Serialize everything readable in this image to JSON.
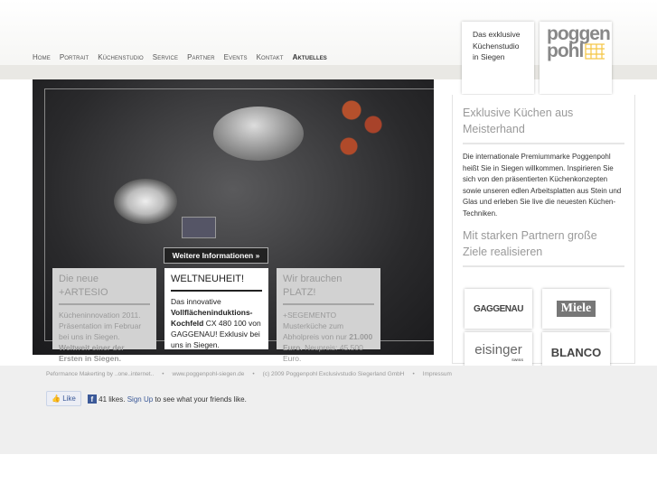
{
  "nav": [
    "Home",
    "Portrait",
    "Küchenstudio",
    "Service",
    "Partner",
    "Events",
    "Kontakt",
    "Aktuelles"
  ],
  "tagline": "Das exklusive Küchenstudio in Siegen",
  "logo": {
    "line1": "poggen",
    "line2": "pohl",
    "accent": "#f5c542"
  },
  "hero": {
    "button": "Weitere Informationen »",
    "boxes": [
      {
        "title": "Die neue +ARTESIO",
        "text": "Kücheninnovation 2011. Präsentation im Februar bei uns in Siegen.",
        "bold": "Weltweit einer der Ersten in Siegen."
      },
      {
        "title": "WELTNEUHEIT!",
        "pre": "Das innovative",
        "bold": "Vollflächeninduktions-Kochfeld",
        "post": "CX 480 100 von GAGGENAU! Exklusiv bei uns in Siegen."
      },
      {
        "title": "Wir brauchen PLATZ!",
        "text": "+SEGEMENTO Musterküche zum Abholpreis von nur",
        "bold": "21.000 Euro.",
        "post": "Neupreis: 45.500 Euro."
      }
    ]
  },
  "sidebar": {
    "heading1": "Exklusive Küchen aus Meisterhand",
    "text": "Die internationale Premiummarke Poggenpohl heißt Sie in Siegen willkommen. Inspirieren Sie sich von den präsentierten Küchenkonzepten sowie unseren edlen Arbeitsplatten aus Stein und Glas und erleben Sie live die neuesten Küchen-Techniken.",
    "heading2": "Mit starken Partnern große Ziele realisieren",
    "brands": [
      "GAGGENAU",
      "Miele",
      "eisinger",
      "SWISS",
      "BLANCO"
    ]
  },
  "footer": {
    "links": [
      "Peformance Makerting by ..one..internet..",
      "•",
      "www.poggenpohl-siegen.de",
      "•",
      "(c) 2009 Poggenpohl Exclusivstudio Siegerland GmbH",
      "•",
      "Impressum"
    ],
    "like": "Like",
    "likes": "41 likes.",
    "signup": "Sign Up",
    "rest": "to see what your friends like."
  }
}
